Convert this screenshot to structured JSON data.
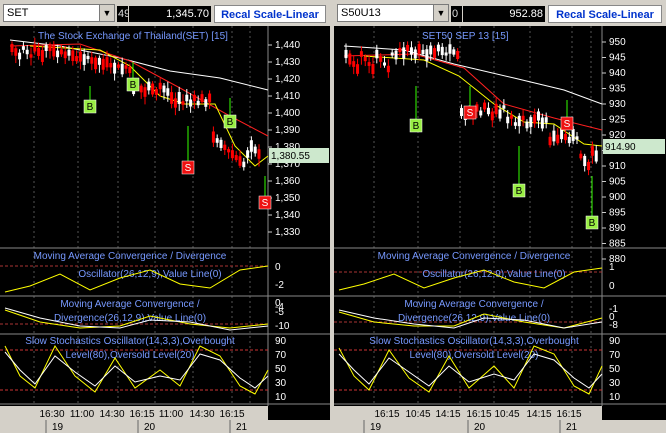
{
  "left": {
    "symbol": "SET",
    "change": "49",
    "price": "1,345.70",
    "recal_label": "Recal Scale-Linear",
    "chart_title": "The Stock Exchange of Thailand(SET) [15]",
    "last_price": "1,380.55",
    "y_ticks": [
      "1,440",
      "1,430",
      "1,420",
      "1,410",
      "1,400",
      "1,390",
      "1,380",
      "1,370",
      "1,360",
      "1,350",
      "1,340",
      "1,330"
    ],
    "macd1_title": [
      "Moving Average Convergence / Divergence",
      "Oscillator(26,12,9),Value Line(0)"
    ],
    "macd1_ticks": [
      "0",
      "-2",
      "-4"
    ],
    "macd2_title": [
      "Moving Average Convergence /",
      "Divergence(26,12,9),Value Line(0)"
    ],
    "macd2_ticks": [
      "0",
      "-5",
      "-10"
    ],
    "stoch_title": [
      "Slow Stochastics Oscillator(14,3,3),Overbought",
      "Level(80),Oversold Level(20)"
    ],
    "stoch_ticks": [
      "90",
      "70",
      "50",
      "30",
      "10"
    ],
    "time_labels": [
      "16:30",
      "11:00",
      "14:30",
      "16:15",
      "11:00",
      "14:30",
      "16:15"
    ],
    "day_labels": [
      "19",
      "20",
      "21"
    ],
    "signals": [
      "B",
      "B",
      "S",
      "B",
      "S",
      "B"
    ]
  },
  "right": {
    "symbol": "S50U13",
    "change": "0",
    "price": "952.88",
    "recal_label": "Recal Scale-Linear",
    "chart_title": "SET50 SEP 13   [15]",
    "last_price": "914.90",
    "y_ticks": [
      "950",
      "945",
      "940",
      "935",
      "930",
      "925",
      "920",
      "915",
      "910",
      "905",
      "900",
      "895",
      "890",
      "885",
      "880"
    ],
    "macd1_title": [
      "Moving Average Convergence / Divergence",
      "Oscillator(26,12,9),Value Line(0)"
    ],
    "macd1_ticks": [
      "1",
      "0",
      "-1"
    ],
    "macd2_title": [
      "Moving Average Convergence /",
      "Divergence(26,12,9),Value Line(0)"
    ],
    "macd2_ticks": [
      "0",
      "-8"
    ],
    "stoch_title": [
      "Slow Stochastics Oscillator(14,3,3),Overbought",
      "Level(80),Oversold Level(20)"
    ],
    "stoch_ticks": [
      "90",
      "70",
      "50",
      "30",
      "10"
    ],
    "time_labels": [
      "16:15",
      "10:45",
      "14:15",
      "16:15",
      "10:45",
      "14:15",
      "16:15"
    ],
    "day_labels": [
      "19",
      "20",
      "21"
    ],
    "signals": [
      "B",
      "S",
      "B",
      "S",
      "B"
    ]
  },
  "colors": {
    "up": "#ffffff",
    "down": "#ff0000",
    "green": "#33ff00",
    "ma_fast": "#ffff00",
    "ma_red": "#ff2020",
    "ma_white": "#ffffff",
    "buy_bg": "#99ee44",
    "sell_bg": "#ee1111",
    "axis_text": "#ffffff",
    "title_text": "#7799ff"
  }
}
